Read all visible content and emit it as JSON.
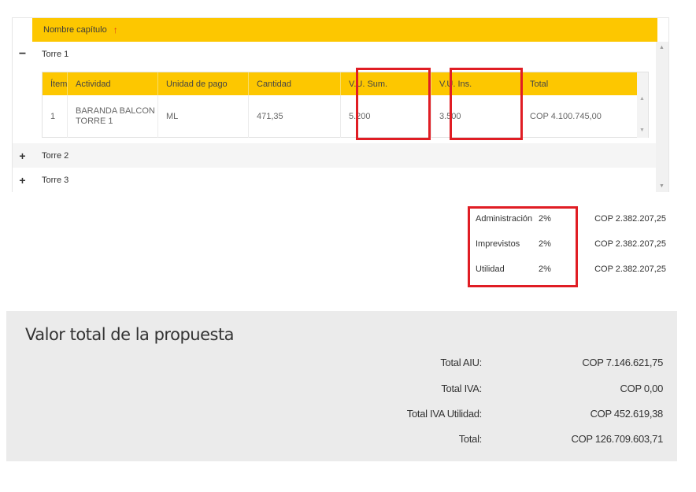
{
  "grid": {
    "header_label": "Nombre capítulo",
    "sort_icon": "↑",
    "groups": [
      {
        "toggle": "−",
        "label": "Torre 1"
      },
      {
        "toggle": "+",
        "label": "Torre 2"
      },
      {
        "toggle": "+",
        "label": "Torre 3"
      }
    ],
    "detail": {
      "columns": [
        "Ítem",
        "Actividad",
        "Unidad de pago",
        "Cantidad",
        "V.U. Sum.",
        "V.U. Ins.",
        "Total"
      ],
      "rows": [
        [
          "1",
          "BARANDA BALCON TORRE 1",
          "ML",
          "471,35",
          "5.200",
          "3.500",
          "COP 4.100.745,00"
        ]
      ]
    }
  },
  "aiu": [
    {
      "name": "Administración",
      "pct": "2%",
      "value": "COP 2.382.207,25"
    },
    {
      "name": "Imprevistos",
      "pct": "2%",
      "value": "COP 2.382.207,25"
    },
    {
      "name": "Utilidad",
      "pct": "2%",
      "value": "COP 2.382.207,25"
    }
  ],
  "totals": {
    "title": "Valor total de la propuesta",
    "rows": [
      {
        "label": "Total AIU:",
        "value": "COP 7.146.621,75"
      },
      {
        "label": "Total IVA:",
        "value": "COP 0,00"
      },
      {
        "label": "Total IVA Utilidad:",
        "value": "COP 452.619,38"
      },
      {
        "label": "Total:",
        "value": "COP 126.709.603,71"
      }
    ]
  },
  "colors": {
    "header_yellow": "#fdc700",
    "highlight_red": "#e01d24",
    "sort_arrow": "#e03a1e"
  }
}
